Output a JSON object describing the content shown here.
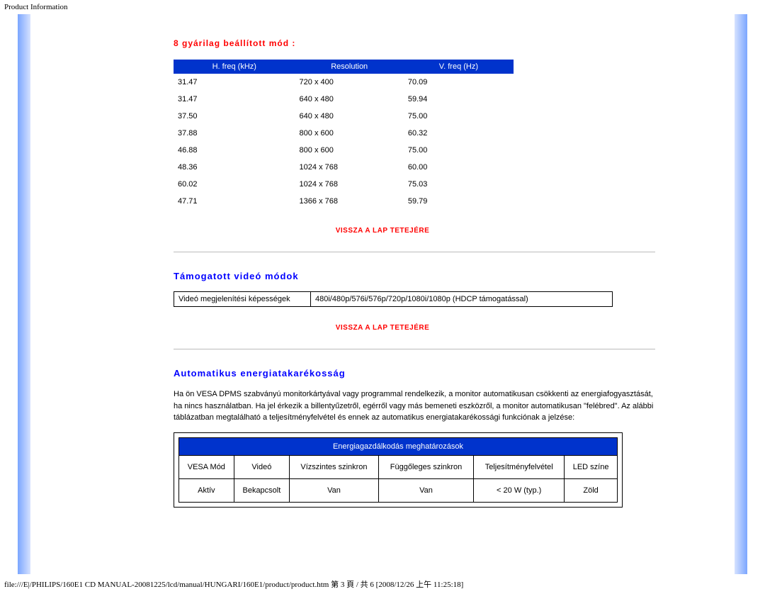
{
  "pageTitle": "Product Information",
  "section1": {
    "title": "8 gyárilag beállított mód :"
  },
  "modesTable": {
    "headers": [
      "H. freq (kHz)",
      "Resolution",
      "V. freq (Hz)"
    ],
    "rows": [
      [
        "31.47",
        "720 x 400",
        "70.09"
      ],
      [
        "31.47",
        "640 x 480",
        "59.94"
      ],
      [
        "37.50",
        "640 x 480",
        "75.00"
      ],
      [
        "37.88",
        "800 x 600",
        "60.32"
      ],
      [
        "46.88",
        "800 x 600",
        "75.00"
      ],
      [
        "48.36",
        "1024 x 768",
        "60.00"
      ],
      [
        "60.02",
        "1024 x 768",
        "75.03"
      ],
      [
        "47.71",
        "1366 x 768",
        "59.79"
      ]
    ]
  },
  "backTop": "VISSZA A LAP TETEJÉRE",
  "section2": {
    "title": "Támogatott videó módok",
    "rowLabel": "Videó megjelenítési képességek",
    "rowValue": "480i/480p/576i/576p/720p/1080i/1080p (HDCP támogatással)"
  },
  "section3": {
    "title": "Automatikus energiatakarékosság",
    "para": "Ha ön VESA DPMS szabványú monitorkártyával vagy programmal rendelkezik, a monitor automatikusan csökkenti az energiafogyasztását, ha nincs használatban. Ha jel érkezik a billentyűzetről, egérről vagy más bemeneti eszközről, a monitor automatikusan \"felébred\". Az alábbi táblázatban megtalálható a teljesítményfelvétel és ennek az automatikus energiatakarékossági funkciónak a jelzése:"
  },
  "energyTable": {
    "caption": "Energiagazdálkodás meghatározások",
    "headers": [
      "VESA Mód",
      "Videó",
      "Vízszintes szinkron",
      "Függőleges szinkron",
      "Teljesítményfelvétel",
      "LED színe"
    ],
    "rows": [
      [
        "Aktív",
        "Bekapcsolt",
        "Van",
        "Van",
        "< 20 W (typ.)",
        "Zöld"
      ]
    ]
  },
  "footerPath": "file:///E|/PHILIPS/160E1 CD MANUAL-20081225/lcd/manual/HUNGARI/160E1/product/product.htm 第 3 頁 / 共 6  [2008/12/26 上午 11:25:18]"
}
